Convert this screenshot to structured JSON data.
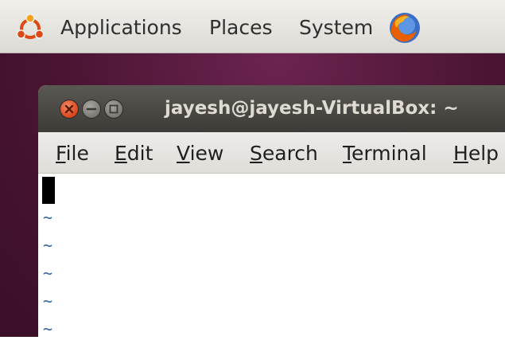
{
  "top_panel": {
    "menus": [
      "Applications",
      "Places",
      "System"
    ],
    "icons": [
      "ubuntu-logo-icon",
      "firefox-icon"
    ]
  },
  "window": {
    "title": "jayesh@jayesh-VirtualBox: ~",
    "controls": [
      "close-icon",
      "minimize-icon",
      "maximize-icon"
    ],
    "menubar": [
      {
        "accel": "F",
        "rest": "ile"
      },
      {
        "accel": "E",
        "rest": "dit"
      },
      {
        "accel": "V",
        "rest": "iew"
      },
      {
        "accel": "S",
        "rest": "earch"
      },
      {
        "accel": "T",
        "rest": "erminal"
      },
      {
        "accel": "H",
        "rest": "elp"
      }
    ],
    "terminal": {
      "tilde_lines": [
        "~",
        "~",
        "~",
        "~",
        "~"
      ]
    }
  },
  "colors": {
    "wallpaper": "#4a1432",
    "close_button": "#d9441b",
    "tilde": "#3465a4",
    "titlebar": "#3d3b37"
  }
}
